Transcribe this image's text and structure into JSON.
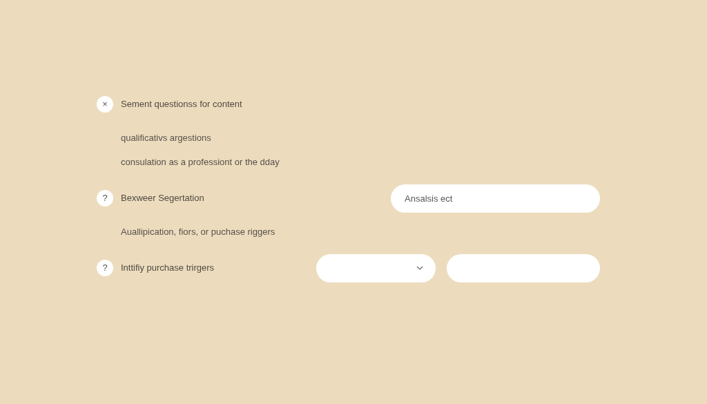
{
  "items": [
    {
      "kind": "question",
      "badge": "×",
      "label": "Sement questionss for content"
    },
    {
      "kind": "note",
      "label": "qualificativs argestions"
    },
    {
      "kind": "note",
      "label": "consulation as a professiont or the dday"
    },
    {
      "kind": "question",
      "badge": "?",
      "label": "Bexweer Segertation",
      "fields": [
        {
          "kind": "text",
          "value": "Ansalsis ect"
        }
      ]
    },
    {
      "kind": "note",
      "label": "Auallipication, fiors, or puchase riggers"
    },
    {
      "kind": "question",
      "badge": "?",
      "label": "Inttifiy purchase trirgers",
      "fields": [
        {
          "kind": "select"
        },
        {
          "kind": "text"
        }
      ]
    }
  ]
}
